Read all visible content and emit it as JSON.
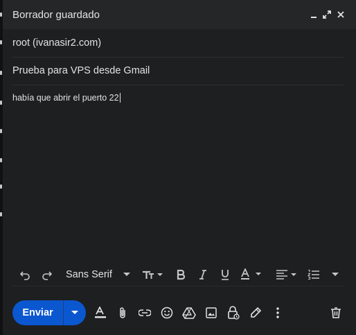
{
  "header": {
    "title": "Borrador guardado"
  },
  "fields": {
    "to": "root (ivanasir2.com)",
    "subject": "Prueba para VPS desde Gmail"
  },
  "body": {
    "text": "había que abrir el puerto 22"
  },
  "format_bar": {
    "font": "Sans Serif"
  },
  "bottom_bar": {
    "send_label": "Enviar"
  },
  "colors": {
    "send_button": "#0b57d0",
    "background": "#1e1f20",
    "header": "#252628"
  },
  "icons": [
    "minimize-icon",
    "expand-icon",
    "close-icon",
    "undo-icon",
    "redo-icon",
    "font-size-icon",
    "bold-icon",
    "italic-icon",
    "underline-icon",
    "text-color-icon",
    "align-icon",
    "numbered-list-icon",
    "more-formatting-icon",
    "formatting-options-icon",
    "attach-icon",
    "link-icon",
    "emoji-icon",
    "drive-icon",
    "photo-icon",
    "confidential-icon",
    "signature-icon",
    "more-options-icon",
    "trash-icon"
  ]
}
